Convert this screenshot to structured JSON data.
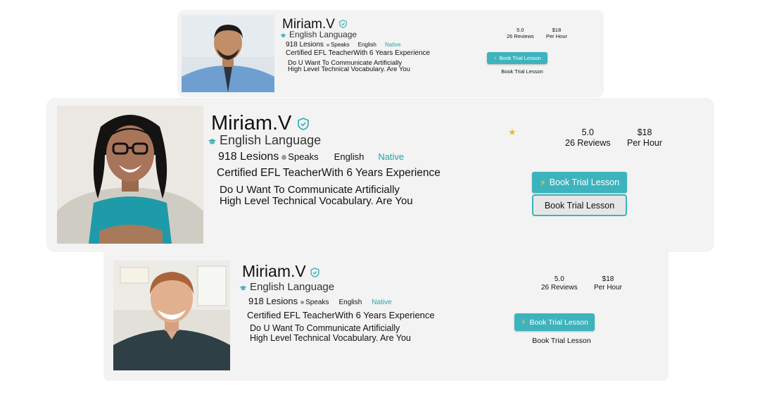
{
  "cards": [
    {
      "name": "Miriam.V",
      "subject": "English Language",
      "lessons": "918 Lesions",
      "speaks_label": "Speaks",
      "language": "English",
      "level": "Native",
      "headline": "Certified EFL TeacherWith 6 Years Experience",
      "description_line1": "Do U Want To Communicate Artificially",
      "description_line2": "High Level Technical Vocabulary. Are You",
      "rating": "5.0",
      "reviews": "26 Reviews",
      "price": "$18",
      "price_unit": "Per Hour",
      "book_button": "Book Trial Lesson",
      "book_secondary": "Book Trial Lesson"
    },
    {
      "name": "Miriam.V",
      "subject": "English Language",
      "lessons": "918 Lesions",
      "speaks_label": "Speaks",
      "language": "English",
      "level": "Native",
      "headline": "Certified EFL TeacherWith 6 Years Experience",
      "description_line1": "Do U Want To Communicate Artificially",
      "description_line2": "High Level Technical Vocabulary. Are You",
      "rating": "5.0",
      "reviews": "26 Reviews",
      "price": "$18",
      "price_unit": "Per Hour",
      "book_button": "Book Trial Lesson",
      "book_secondary": "Book Trial Lesson"
    },
    {
      "name": "Miriam.V",
      "subject": "English Language",
      "lessons": "918 Lesions",
      "speaks_label": "Speaks",
      "language": "English",
      "level": "Native",
      "headline": "Certified EFL TeacherWith 6 Years Experience",
      "description_line1": "Do U Want To Communicate Artificially",
      "description_line2": "High Level Technical Vocabulary. Are You",
      "rating": "5.0",
      "reviews": "26 Reviews",
      "price": "$18",
      "price_unit": "Per Hour",
      "book_button": "Book Trial Lesson",
      "book_secondary": "Book Trial Lesson"
    }
  ],
  "colors": {
    "accent": "#3db3bd",
    "native_text": "#2aa3a6",
    "star": "#f2b822",
    "bolt": "#ffd53b",
    "card_bg": "#f3f3f3"
  },
  "icons": [
    "verified-badge-icon",
    "graduation-cap-icon",
    "star-icon",
    "lightning-bolt-icon"
  ]
}
